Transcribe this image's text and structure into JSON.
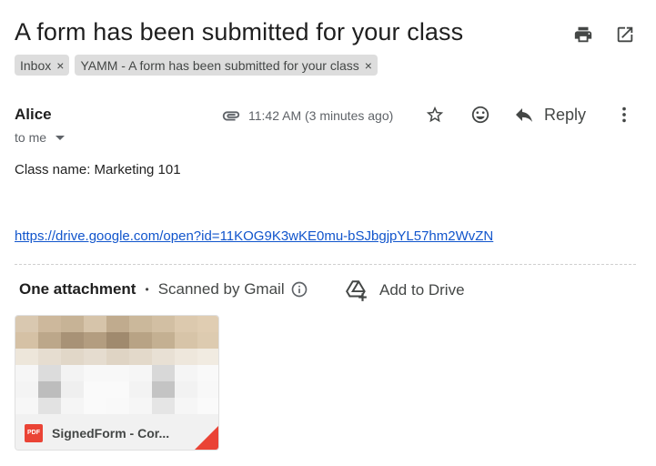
{
  "email": {
    "subject": "A form has been submitted for your class",
    "labels": [
      {
        "text": "Inbox",
        "remove": "×"
      },
      {
        "text": "YAMM - A form has been submitted for your class",
        "remove": "×"
      }
    ],
    "sender": "Alice",
    "recipient": "to me",
    "time": "11:42 AM (3 minutes ago)",
    "reply_label": "Reply",
    "body_line": "Class name: Marketing 101",
    "link": "https://drive.google.com/open?id=11KOG9K3wKE0mu-bSJbgjpYL57hm2WvZN"
  },
  "attachments": {
    "title": "One attachment",
    "separator": "•",
    "scanned": "Scanned by Gmail",
    "add_to_drive": "Add to Drive",
    "file_name": "SignedForm - Cor...",
    "file_type": "PDF"
  },
  "colors": {
    "link": "#1155cc",
    "pdf_red": "#ea4335",
    "chip_bg": "#dddddd"
  }
}
